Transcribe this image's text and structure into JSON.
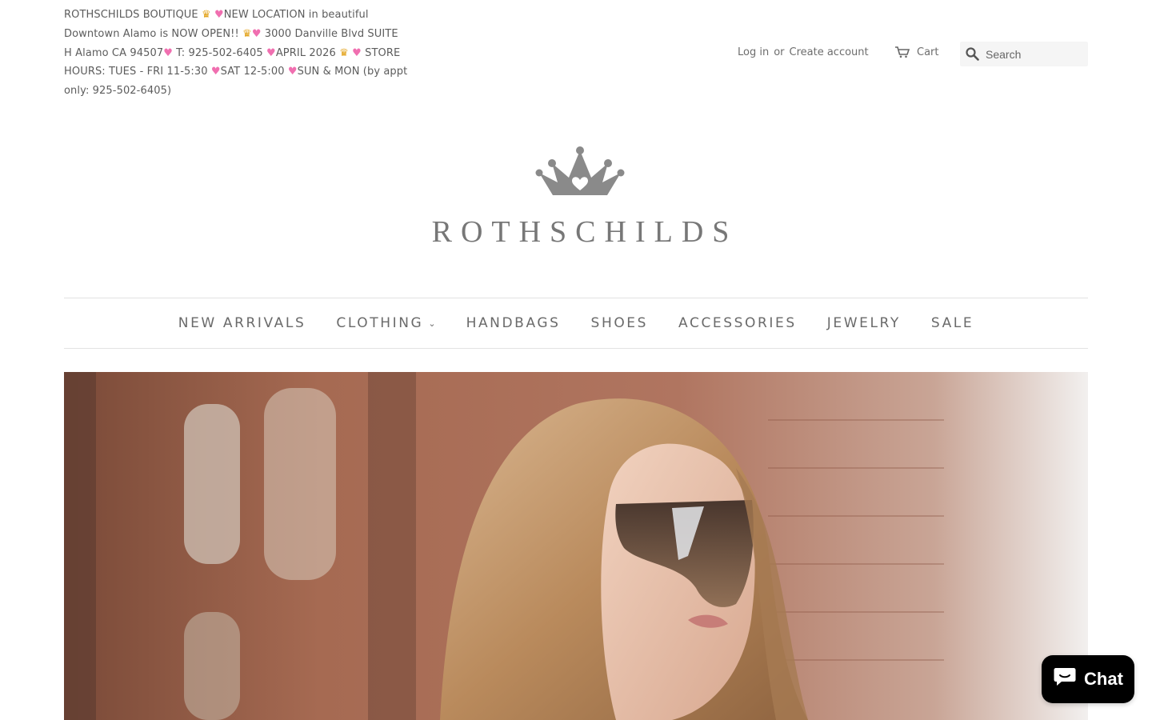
{
  "announcement": {
    "line1": "ROTHSCHILDS BOUTIQUE ",
    "seg_new_location": "NEW LOCATION in beautiful Downtown Alamo is NOW OPEN!! ",
    "seg_address": " 3000 Danville Blvd SUITE H Alamo CA 94507",
    "seg_phone": " T: 925-502-6405 ",
    "seg_april": "APRIL 2026 ",
    "seg_hours": " STORE HOURS: TUES - FRI 11-5:30 ",
    "seg_sat": "SAT 12-5:00 ",
    "seg_sun": "SUN & MON (by appt only: 925-502-6405)",
    "heart": "♥",
    "crown": "♛"
  },
  "account": {
    "login": "Log in",
    "or": "or",
    "create": "Create account"
  },
  "cart": {
    "label": "Cart",
    "icon": "cart-icon"
  },
  "search": {
    "placeholder": "Search",
    "value": ""
  },
  "logo": {
    "wordmark": "ROTHSCHILDS"
  },
  "nav": {
    "items": [
      {
        "label": "NEW ARRIVALS"
      },
      {
        "label": "CLOTHING",
        "dropdown": true
      },
      {
        "label": "HANDBAGS"
      },
      {
        "label": "SHOES"
      },
      {
        "label": "ACCESSORIES"
      },
      {
        "label": "JEWELRY"
      },
      {
        "label": "SALE"
      }
    ],
    "chevron": "⌄"
  },
  "chat": {
    "label": "Chat"
  },
  "colors": {
    "text": "#636363",
    "heart": "#f06fb0",
    "chat_bg": "#000000",
    "search_bg": "#f5f5f5"
  }
}
